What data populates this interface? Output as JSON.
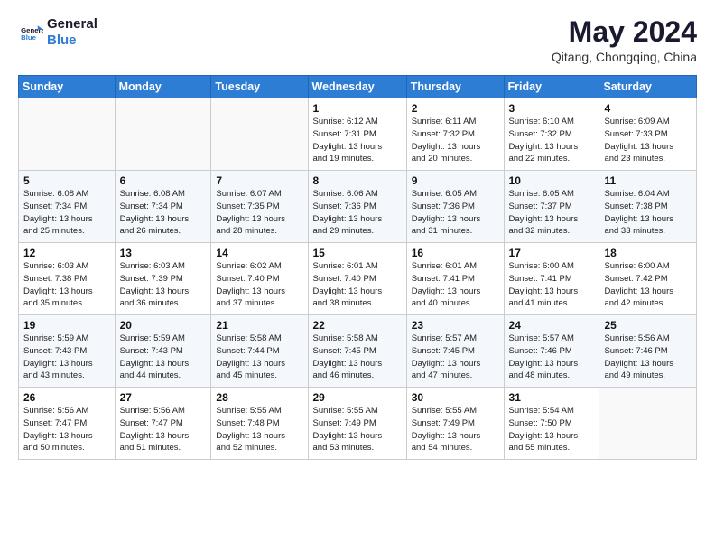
{
  "header": {
    "logo_line1": "General",
    "logo_line2": "Blue",
    "month_year": "May 2024",
    "location": "Qitang, Chongqing, China"
  },
  "weekdays": [
    "Sunday",
    "Monday",
    "Tuesday",
    "Wednesday",
    "Thursday",
    "Friday",
    "Saturday"
  ],
  "weeks": [
    [
      {
        "day": "",
        "info": ""
      },
      {
        "day": "",
        "info": ""
      },
      {
        "day": "",
        "info": ""
      },
      {
        "day": "1",
        "info": "Sunrise: 6:12 AM\nSunset: 7:31 PM\nDaylight: 13 hours\nand 19 minutes."
      },
      {
        "day": "2",
        "info": "Sunrise: 6:11 AM\nSunset: 7:32 PM\nDaylight: 13 hours\nand 20 minutes."
      },
      {
        "day": "3",
        "info": "Sunrise: 6:10 AM\nSunset: 7:32 PM\nDaylight: 13 hours\nand 22 minutes."
      },
      {
        "day": "4",
        "info": "Sunrise: 6:09 AM\nSunset: 7:33 PM\nDaylight: 13 hours\nand 23 minutes."
      }
    ],
    [
      {
        "day": "5",
        "info": "Sunrise: 6:08 AM\nSunset: 7:34 PM\nDaylight: 13 hours\nand 25 minutes."
      },
      {
        "day": "6",
        "info": "Sunrise: 6:08 AM\nSunset: 7:34 PM\nDaylight: 13 hours\nand 26 minutes."
      },
      {
        "day": "7",
        "info": "Sunrise: 6:07 AM\nSunset: 7:35 PM\nDaylight: 13 hours\nand 28 minutes."
      },
      {
        "day": "8",
        "info": "Sunrise: 6:06 AM\nSunset: 7:36 PM\nDaylight: 13 hours\nand 29 minutes."
      },
      {
        "day": "9",
        "info": "Sunrise: 6:05 AM\nSunset: 7:36 PM\nDaylight: 13 hours\nand 31 minutes."
      },
      {
        "day": "10",
        "info": "Sunrise: 6:05 AM\nSunset: 7:37 PM\nDaylight: 13 hours\nand 32 minutes."
      },
      {
        "day": "11",
        "info": "Sunrise: 6:04 AM\nSunset: 7:38 PM\nDaylight: 13 hours\nand 33 minutes."
      }
    ],
    [
      {
        "day": "12",
        "info": "Sunrise: 6:03 AM\nSunset: 7:38 PM\nDaylight: 13 hours\nand 35 minutes."
      },
      {
        "day": "13",
        "info": "Sunrise: 6:03 AM\nSunset: 7:39 PM\nDaylight: 13 hours\nand 36 minutes."
      },
      {
        "day": "14",
        "info": "Sunrise: 6:02 AM\nSunset: 7:40 PM\nDaylight: 13 hours\nand 37 minutes."
      },
      {
        "day": "15",
        "info": "Sunrise: 6:01 AM\nSunset: 7:40 PM\nDaylight: 13 hours\nand 38 minutes."
      },
      {
        "day": "16",
        "info": "Sunrise: 6:01 AM\nSunset: 7:41 PM\nDaylight: 13 hours\nand 40 minutes."
      },
      {
        "day": "17",
        "info": "Sunrise: 6:00 AM\nSunset: 7:41 PM\nDaylight: 13 hours\nand 41 minutes."
      },
      {
        "day": "18",
        "info": "Sunrise: 6:00 AM\nSunset: 7:42 PM\nDaylight: 13 hours\nand 42 minutes."
      }
    ],
    [
      {
        "day": "19",
        "info": "Sunrise: 5:59 AM\nSunset: 7:43 PM\nDaylight: 13 hours\nand 43 minutes."
      },
      {
        "day": "20",
        "info": "Sunrise: 5:59 AM\nSunset: 7:43 PM\nDaylight: 13 hours\nand 44 minutes."
      },
      {
        "day": "21",
        "info": "Sunrise: 5:58 AM\nSunset: 7:44 PM\nDaylight: 13 hours\nand 45 minutes."
      },
      {
        "day": "22",
        "info": "Sunrise: 5:58 AM\nSunset: 7:45 PM\nDaylight: 13 hours\nand 46 minutes."
      },
      {
        "day": "23",
        "info": "Sunrise: 5:57 AM\nSunset: 7:45 PM\nDaylight: 13 hours\nand 47 minutes."
      },
      {
        "day": "24",
        "info": "Sunrise: 5:57 AM\nSunset: 7:46 PM\nDaylight: 13 hours\nand 48 minutes."
      },
      {
        "day": "25",
        "info": "Sunrise: 5:56 AM\nSunset: 7:46 PM\nDaylight: 13 hours\nand 49 minutes."
      }
    ],
    [
      {
        "day": "26",
        "info": "Sunrise: 5:56 AM\nSunset: 7:47 PM\nDaylight: 13 hours\nand 50 minutes."
      },
      {
        "day": "27",
        "info": "Sunrise: 5:56 AM\nSunset: 7:47 PM\nDaylight: 13 hours\nand 51 minutes."
      },
      {
        "day": "28",
        "info": "Sunrise: 5:55 AM\nSunset: 7:48 PM\nDaylight: 13 hours\nand 52 minutes."
      },
      {
        "day": "29",
        "info": "Sunrise: 5:55 AM\nSunset: 7:49 PM\nDaylight: 13 hours\nand 53 minutes."
      },
      {
        "day": "30",
        "info": "Sunrise: 5:55 AM\nSunset: 7:49 PM\nDaylight: 13 hours\nand 54 minutes."
      },
      {
        "day": "31",
        "info": "Sunrise: 5:54 AM\nSunset: 7:50 PM\nDaylight: 13 hours\nand 55 minutes."
      },
      {
        "day": "",
        "info": ""
      }
    ]
  ]
}
